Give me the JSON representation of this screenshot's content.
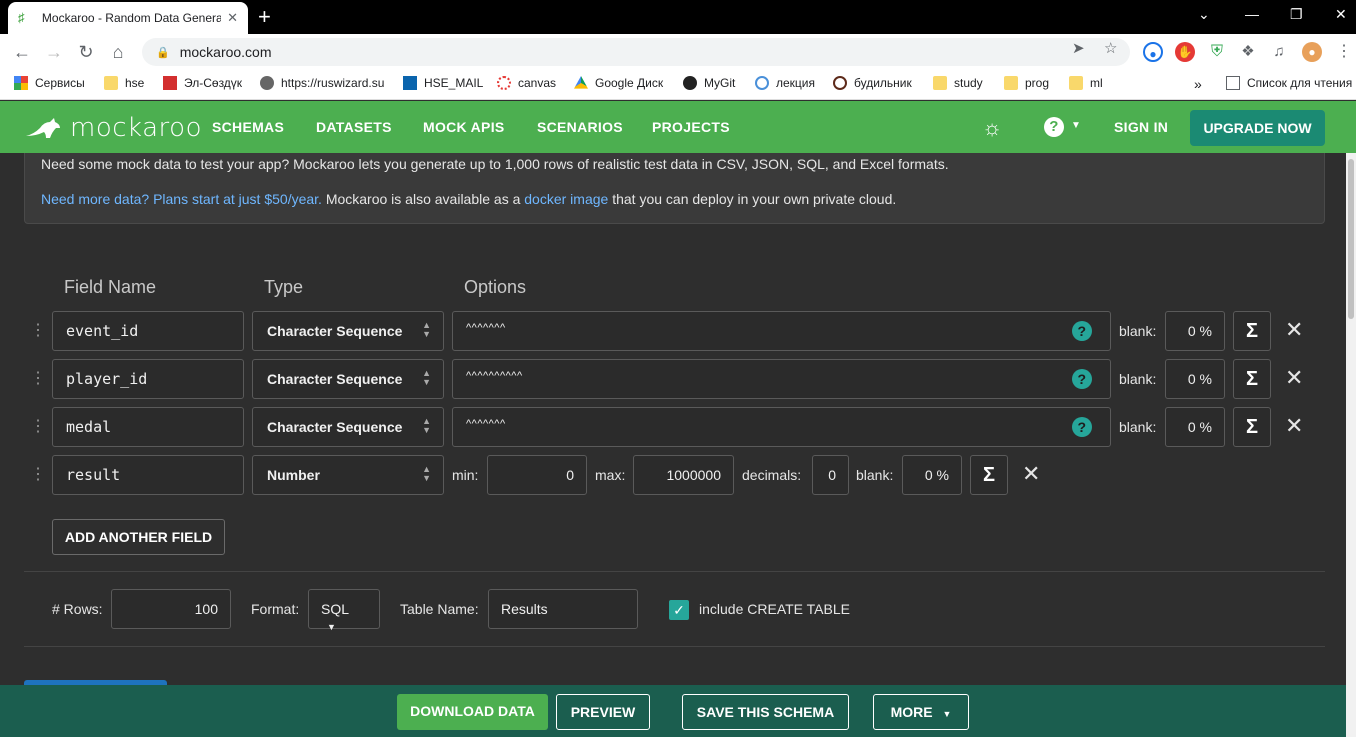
{
  "browser": {
    "tab_title": "Mockaroo - Random Data Generat",
    "url": "mockaroo.com",
    "bookmarks": [
      "Сервисы",
      "hse",
      "Эл-Сөздүк",
      "https://ruswizard.su",
      "HSE_MAIL",
      "canvas",
      "Google Диск",
      "MyGit",
      "лекция",
      "будильник",
      "study",
      "prog",
      "ml"
    ],
    "reading_list": "Список для чтения"
  },
  "header": {
    "logo": "mockaroo",
    "nav": [
      "SCHEMAS",
      "DATASETS",
      "MOCK APIS",
      "SCENARIOS",
      "PROJECTS"
    ],
    "sign_in": "SIGN IN",
    "upgrade": "UPGRADE NOW"
  },
  "info": {
    "line1": "Need some mock data to test your app? Mockaroo lets you generate up to 1,000 rows of realistic test data in CSV, JSON, SQL, and Excel formats.",
    "line2_link1": "Need more data? Plans start at just $50/year.",
    "line2_text1": " Mockaroo is also available as a ",
    "line2_link2": "docker image",
    "line2_text2": " that you can deploy in your own private cloud."
  },
  "columns": {
    "field_name": "Field Name",
    "type": "Type",
    "options": "Options"
  },
  "fields": [
    {
      "name": "event_id",
      "type": "Character Sequence",
      "options": "^^^^^^^",
      "blank": "0 %"
    },
    {
      "name": "player_id",
      "type": "Character Sequence",
      "options": "^^^^^^^^^^",
      "blank": "0 %"
    },
    {
      "name": "medal",
      "type": "Character Sequence",
      "options": "^^^^^^^",
      "blank": "0 %"
    },
    {
      "name": "result",
      "type": "Number",
      "min": "0",
      "max": "1000000",
      "decimals": "0",
      "blank": "0 %"
    }
  ],
  "labels": {
    "blank": "blank:",
    "min": "min:",
    "max": "max:",
    "decimals": "decimals:"
  },
  "add_field": "ADD ANOTHER FIELD",
  "output": {
    "rows_label": "# Rows:",
    "rows_value": "100",
    "format_label": "Format:",
    "format_value": "SQL",
    "table_label": "Table Name:",
    "table_value": "Results",
    "create_table": "include CREATE TABLE"
  },
  "footer": {
    "download": "DOWNLOAD DATA",
    "preview": "PREVIEW",
    "save": "SAVE THIS SCHEMA",
    "more": "MORE"
  },
  "colors": {
    "brand_green": "#4caf50",
    "teal": "#1b8a73",
    "footer": "#1b5e4f",
    "background": "#2e2e2e"
  }
}
